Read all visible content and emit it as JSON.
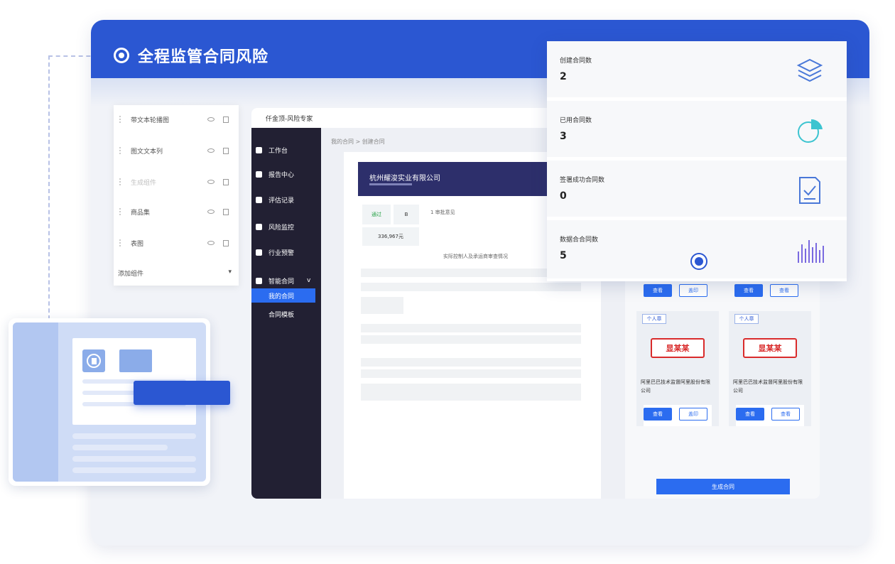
{
  "headline": {
    "title": "全程监管合同风险"
  },
  "component_panel": {
    "items": [
      {
        "label": "带文本轮播图",
        "faded": false
      },
      {
        "label": "图文文本列",
        "faded": false
      },
      {
        "label": "生成组件",
        "faded": true
      },
      {
        "label": "商品集",
        "faded": false
      },
      {
        "label": "表图",
        "faded": false
      }
    ],
    "add_label": "添加组件"
  },
  "app": {
    "brand": "仟金顶-风险专家",
    "breadcrumb": "我的合同 > 创建合同",
    "nav": [
      {
        "label": "工作台"
      },
      {
        "label": "报告中心"
      },
      {
        "label": "评估记录"
      },
      {
        "label": "风险监控"
      },
      {
        "label": "行业预警"
      },
      {
        "label": "智能合同"
      }
    ],
    "nav_sub": [
      {
        "label": "我的合同",
        "active": true
      },
      {
        "label": "合同模板",
        "active": false
      }
    ],
    "document": {
      "company": "杭州耀浚实业有限公司",
      "tag_pass": "通过",
      "section_title": "1 审批意见",
      "amount": "336,967元",
      "table_title": "实际控制人及承运商审查情况"
    },
    "seal_cards": [
      {
        "tag": "个人章",
        "seal": "显某某",
        "company": "阿里巴巴技术监督阿里股份有限公司",
        "btn_primary": "查看",
        "btn_secondary": "盖印"
      },
      {
        "tag": "个人章",
        "seal": "显某某",
        "company": "阿里巴巴技术监督阿里股份有限公司",
        "btn_primary": "查看",
        "btn_secondary": "查看"
      }
    ],
    "top_buttons": [
      {
        "primary": "查看",
        "secondary": "盖印"
      },
      {
        "primary": "查看",
        "secondary": "查看"
      }
    ],
    "generate_button": "生成合同"
  },
  "stats": [
    {
      "label": "创建合同数",
      "value": "2",
      "icon": "layers-icon",
      "color": "#4a78d8"
    },
    {
      "label": "已用合同数",
      "value": "3",
      "icon": "pie-chart-icon",
      "color": "#3cc4d0"
    },
    {
      "label": "签署成功合同数",
      "value": "0",
      "icon": "document-check-icon",
      "color": "#4a78d8"
    },
    {
      "label": "数据合合同数",
      "value": "5",
      "icon": "bar-chart-icon",
      "color": "#7a6ae0"
    }
  ],
  "colors": {
    "brand": "#2b57d2",
    "accent": "#2b6cf0",
    "sidebar": "#222033",
    "seal": "#d92b2b"
  }
}
